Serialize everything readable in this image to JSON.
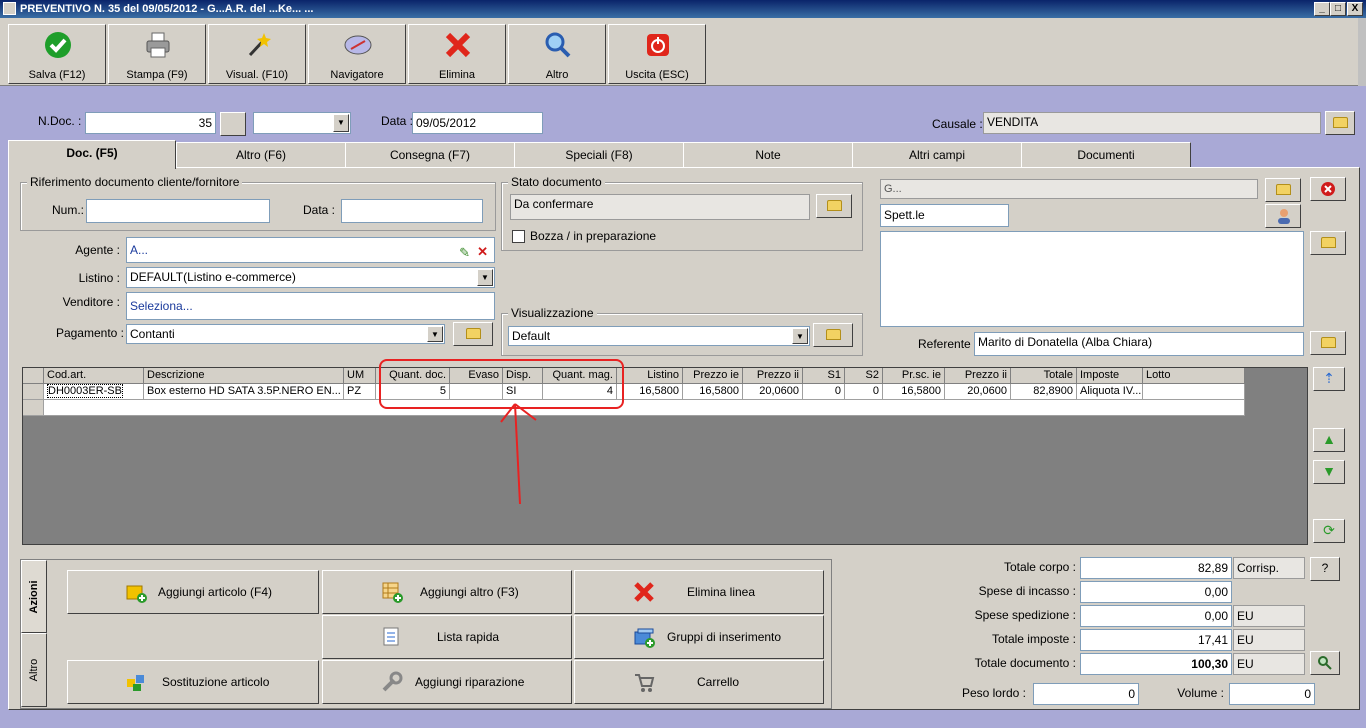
{
  "window": {
    "title": "PREVENTIVO N. 35  del 09/05/2012 - G...A.R. del ...Ke... ...",
    "min": "_",
    "max": "□",
    "close": "X"
  },
  "toolbar": [
    {
      "label": "Salva (F12)",
      "icon": "check-icon"
    },
    {
      "label": "Stampa (F9)",
      "icon": "printer-icon"
    },
    {
      "label": "Visual. (F10)",
      "icon": "magic-wand-icon"
    },
    {
      "label": "Navigatore",
      "icon": "compass-icon"
    },
    {
      "label": "Elimina",
      "icon": "delete-x-icon"
    },
    {
      "label": "Altro",
      "icon": "magnifier-icon"
    },
    {
      "label": "Uscita (ESC)",
      "icon": "exit-icon"
    }
  ],
  "header": {
    "ndoc_label": "N.Doc. :",
    "ndoc_value": "35",
    "data_label": "Data :",
    "data_value": "09/05/2012",
    "causale_label": "Causale :",
    "causale_value": "VENDITA"
  },
  "tabs": [
    "Doc. (F5)",
    "Altro (F6)",
    "Consegna (F7)",
    "Speciali (F8)",
    "Note",
    "Altri campi",
    "Documenti"
  ],
  "rif": {
    "title": "Riferimento documento cliente/fornitore",
    "num_label": "Num.:",
    "num_value": "",
    "data_label": "Data :",
    "data_value": ""
  },
  "stato": {
    "title": "Stato documento",
    "value": "Da confermare",
    "bozza_label": "Bozza / in preparazione"
  },
  "form": {
    "agente_label": "Agente :",
    "agente_value": "A...",
    "listino_label": "Listino :",
    "listino_value": "DEFAULT(Listino e-commerce)",
    "venditore_label": "Venditore :",
    "venditore_value": "Seleziona...",
    "pagamento_label": "Pagamento :",
    "pagamento_value": "Contanti"
  },
  "visual": {
    "title": "Visualizzazione",
    "value": "Default"
  },
  "cliente": {
    "name": "G...",
    "spett": "Spett.le",
    "referente_label": "Referente",
    "referente_value": "Marito di Donatella (Alba Chiara)"
  },
  "grid": {
    "headers": [
      "Cod.art.",
      "Descrizione",
      "UM",
      "Quant. doc.",
      "Evaso",
      "Disp.",
      "Quant. mag.",
      "Listino",
      "Prezzo ie",
      "Prezzo ii",
      "S1",
      "S2",
      "Pr.sc. ie",
      "Prezzo ii",
      "Totale",
      "Imposte",
      "Lotto"
    ],
    "rows": [
      [
        "DH0003ER-SB",
        "Box esterno HD SATA 3.5P.NERO EN...",
        "PZ",
        "5",
        "",
        "SI",
        "4",
        "16,5800",
        "16,5800",
        "20,0600",
        "0",
        "0",
        "16,5800",
        "20,0600",
        "82,8900",
        "Aliquota IV...",
        ""
      ]
    ]
  },
  "actions": {
    "tab_azioni": "Azioni",
    "tab_altro": "Altro",
    "buttons": [
      {
        "label": "Aggiungi articolo (F4)",
        "icon": "box-add-icon"
      },
      {
        "label": "Aggiungi altro (F3)",
        "icon": "grid-add-icon"
      },
      {
        "label": "Elimina linea",
        "icon": "red-x-icon"
      },
      {
        "label": "Lista rapida",
        "icon": "list-icon"
      },
      {
        "label": "Gruppi di inserimento",
        "icon": "group-icon"
      },
      {
        "label": "Sostituzione articolo",
        "icon": "swap-icon"
      },
      {
        "label": "Aggiungi riparazione",
        "icon": "wrench-icon"
      },
      {
        "label": "Carrello",
        "icon": "cart-icon"
      }
    ]
  },
  "totals": {
    "corpo_label": "Totale corpo :",
    "corpo_value": "82,89",
    "corrisp": "Corrisp.",
    "help": "?",
    "incasso_label": "Spese di incasso :",
    "incasso_value": "0,00",
    "spedizione_label": "Spese spedizione :",
    "spedizione_value": "0,00",
    "spedizione_cur": "EU",
    "imposte_label": "Totale imposte :",
    "imposte_value": "17,41",
    "imposte_cur": "EU",
    "documento_label": "Totale documento :",
    "documento_value": "100,30",
    "documento_cur": "EU",
    "peso_label": "Peso lordo :",
    "peso_value": "0",
    "volume_label": "Volume :",
    "volume_value": "0"
  },
  "colors": {
    "annotation": "#e82222",
    "background": "#a9a9d6",
    "panel": "#d4d0c8"
  }
}
